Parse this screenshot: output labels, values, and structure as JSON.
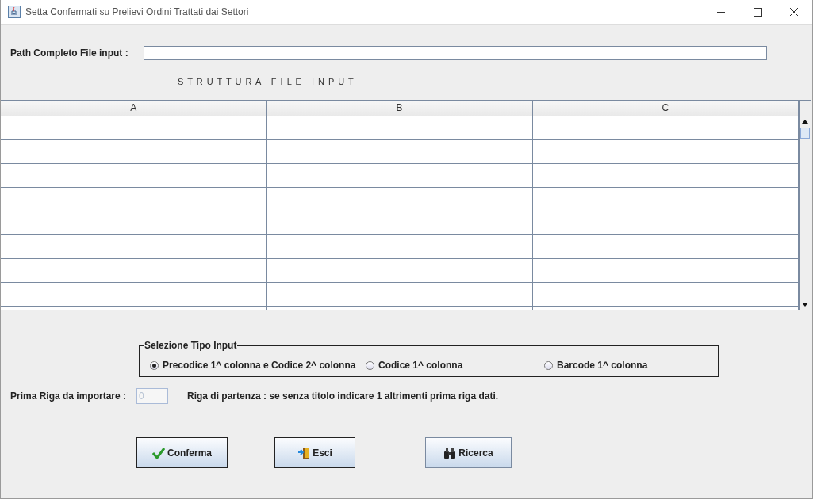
{
  "window": {
    "title": "Setta Confermati su Prelievi Ordini Trattati dai Settori"
  },
  "path_field": {
    "label": "Path Completo File input :"
  },
  "section_title": "S T R U T T U R A   F I L E   I N P U T",
  "table": {
    "columns": [
      "A",
      "B",
      "C"
    ]
  },
  "input_type": {
    "title": "Selezione Tipo Input",
    "options": [
      {
        "label": "Precodice 1^ colonna e Codice 2^ colonna",
        "selected": true
      },
      {
        "label": "Codice 1^ colonna",
        "selected": false
      },
      {
        "label": "Barcode 1^ colonna",
        "selected": false
      }
    ]
  },
  "first_row": {
    "label": "Prima Riga da importare :",
    "value": "0",
    "disabled": true,
    "hint": "Riga di partenza : se senza titolo indicare 1 altrimenti prima riga dati."
  },
  "buttons": [
    {
      "label": "Conferma",
      "kind": "confirm"
    },
    {
      "label": "Esci",
      "kind": "exit"
    },
    {
      "label": "Ricerca",
      "kind": "search"
    }
  ]
}
